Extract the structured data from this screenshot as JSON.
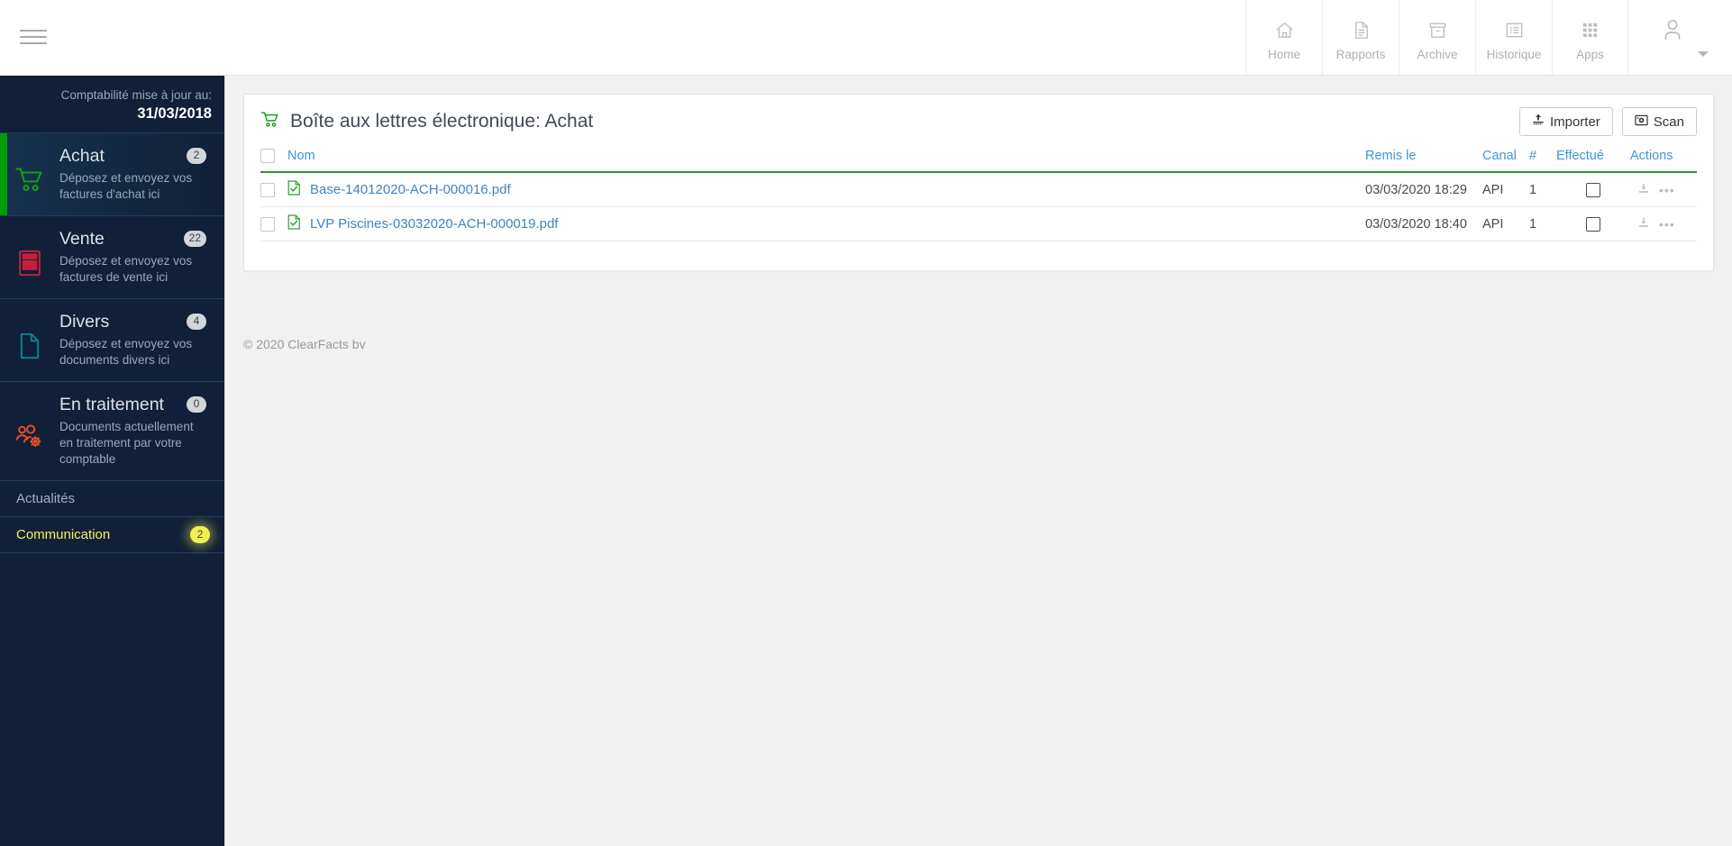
{
  "topbar": {
    "menu_icon": "hamburger-icon",
    "nav": [
      {
        "label": "Home",
        "icon": "home-icon"
      },
      {
        "label": "Rapports",
        "icon": "document-icon"
      },
      {
        "label": "Archive",
        "icon": "archive-box-icon"
      },
      {
        "label": "Historique",
        "icon": "list-icon"
      },
      {
        "label": "Apps",
        "icon": "grid-apps-icon"
      }
    ],
    "user": {
      "icon": "user-avatar-icon",
      "caret": "chevron-down-icon"
    }
  },
  "sidebar": {
    "accounting": {
      "label": "Comptabilité mise à jour au:",
      "date": "31/03/2018"
    },
    "items": [
      {
        "title": "Achat",
        "desc": "Déposez et envoyez vos factures d'achat ici",
        "badge": "2",
        "icon": "shopping-cart-icon",
        "active": true
      },
      {
        "title": "Vente",
        "desc": "Déposez et envoyez vos factures de vente ici",
        "badge": "22",
        "icon": "calculator-icon",
        "active": false
      },
      {
        "title": "Divers",
        "desc": "Déposez et envoyez vos documents divers ici",
        "badge": "4",
        "icon": "file-icon",
        "active": false
      },
      {
        "title": "En traitement",
        "desc": "Documents actuellement en traitement par votre comptable",
        "badge": "0",
        "icon": "users-gear-icon",
        "active": false
      }
    ],
    "simple_items": [
      {
        "label": "Actualités",
        "badge": "",
        "highlight": false
      },
      {
        "label": "Communication",
        "badge": "2",
        "highlight": true
      }
    ]
  },
  "main": {
    "card": {
      "title": "Boîte aux lettres électronique: Achat",
      "title_icon": "shopping-cart-icon",
      "buttons": [
        {
          "label": "Importer",
          "icon": "upload-icon"
        },
        {
          "label": "Scan",
          "icon": "camera-icon"
        }
      ],
      "table": {
        "columns": [
          {
            "key": "select",
            "label": "",
            "link": false
          },
          {
            "key": "nom",
            "label": "Nom",
            "link": true
          },
          {
            "key": "remis",
            "label": "Remis le",
            "link": true
          },
          {
            "key": "canal",
            "label": "Canal",
            "link": true
          },
          {
            "key": "count",
            "label": "#",
            "link": true
          },
          {
            "key": "effectue",
            "label": "Effectué",
            "link": false
          },
          {
            "key": "actions",
            "label": "Actions",
            "link": false
          }
        ],
        "rows": [
          {
            "name": "Base-14012020-ACH-000016.pdf",
            "file_icon": "pdf-check-icon",
            "remis_le": "03/03/2020 18:29",
            "canal": "API",
            "count": "1",
            "effectue": false,
            "actions": {
              "download": "download-icon",
              "more": "more-dots-icon"
            }
          },
          {
            "name": "LVP Piscines-03032020-ACH-000019.pdf",
            "file_icon": "pdf-check-icon",
            "remis_le": "03/03/2020 18:40",
            "canal": "API",
            "count": "1",
            "effectue": false,
            "actions": {
              "download": "download-icon",
              "more": "more-dots-icon"
            }
          }
        ]
      }
    },
    "footer": "© 2020 ClearFacts bv"
  },
  "colors": {
    "sidebar_bg": "#102038",
    "active_accent": "#049c0b",
    "link_blue": "#3e84c4",
    "header_link": "#3e96d6",
    "table_rule_green": "#2c972c",
    "badge_yellow": "#f2ef52",
    "vente_red": "#c2203f",
    "divers_teal": "#137b8e",
    "traitement_orange": "#e8502a"
  }
}
